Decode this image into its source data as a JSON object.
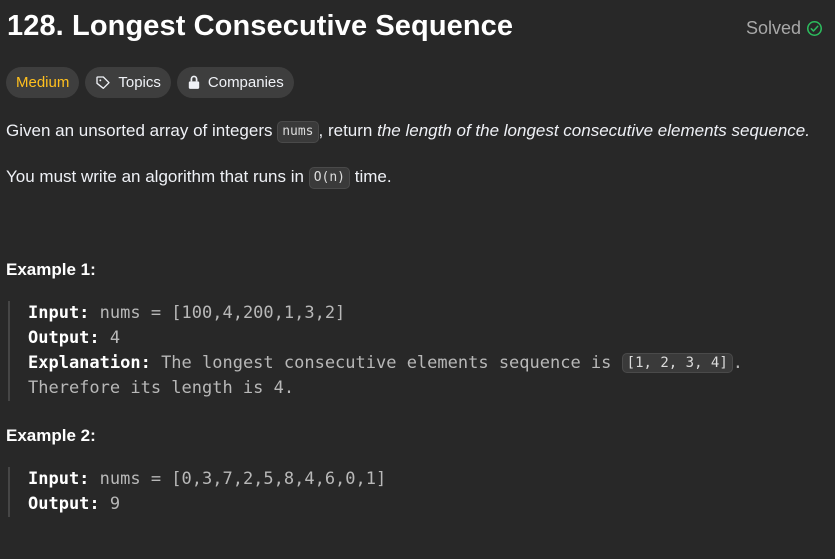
{
  "problem": {
    "title": "128. Longest Consecutive Sequence",
    "status": "Solved"
  },
  "tags": {
    "difficulty": "Medium",
    "topics": "Topics",
    "companies": "Companies"
  },
  "description": {
    "p1_before": "Given an unsorted array of integers ",
    "p1_code": "nums",
    "p1_mid": ", return ",
    "p1_em": "the length of the longest consecutive elements sequence.",
    "p2_before": "You must write an algorithm that runs in ",
    "p2_code": "O(n)",
    "p2_after": " time."
  },
  "examples": [
    {
      "title": "Example 1:",
      "input_label": "Input:",
      "input_value": " nums = [100,4,200,1,3,2]",
      "output_label": "Output:",
      "output_value": " 4",
      "explanation_label": "Explanation:",
      "explanation_before": " The longest consecutive elements sequence is ",
      "explanation_code": "[1, 2, 3, 4]",
      "explanation_after": ".",
      "explanation_line2": "Therefore its length is 4."
    },
    {
      "title": "Example 2:",
      "input_label": "Input:",
      "input_value": " nums = [0,3,7,2,5,8,4,6,0,1]",
      "output_label": "Output:",
      "output_value": " 9"
    }
  ],
  "colors": {
    "background": "#282828",
    "difficulty_medium": "#ffc01e",
    "solved_check": "#2cbb5d"
  }
}
